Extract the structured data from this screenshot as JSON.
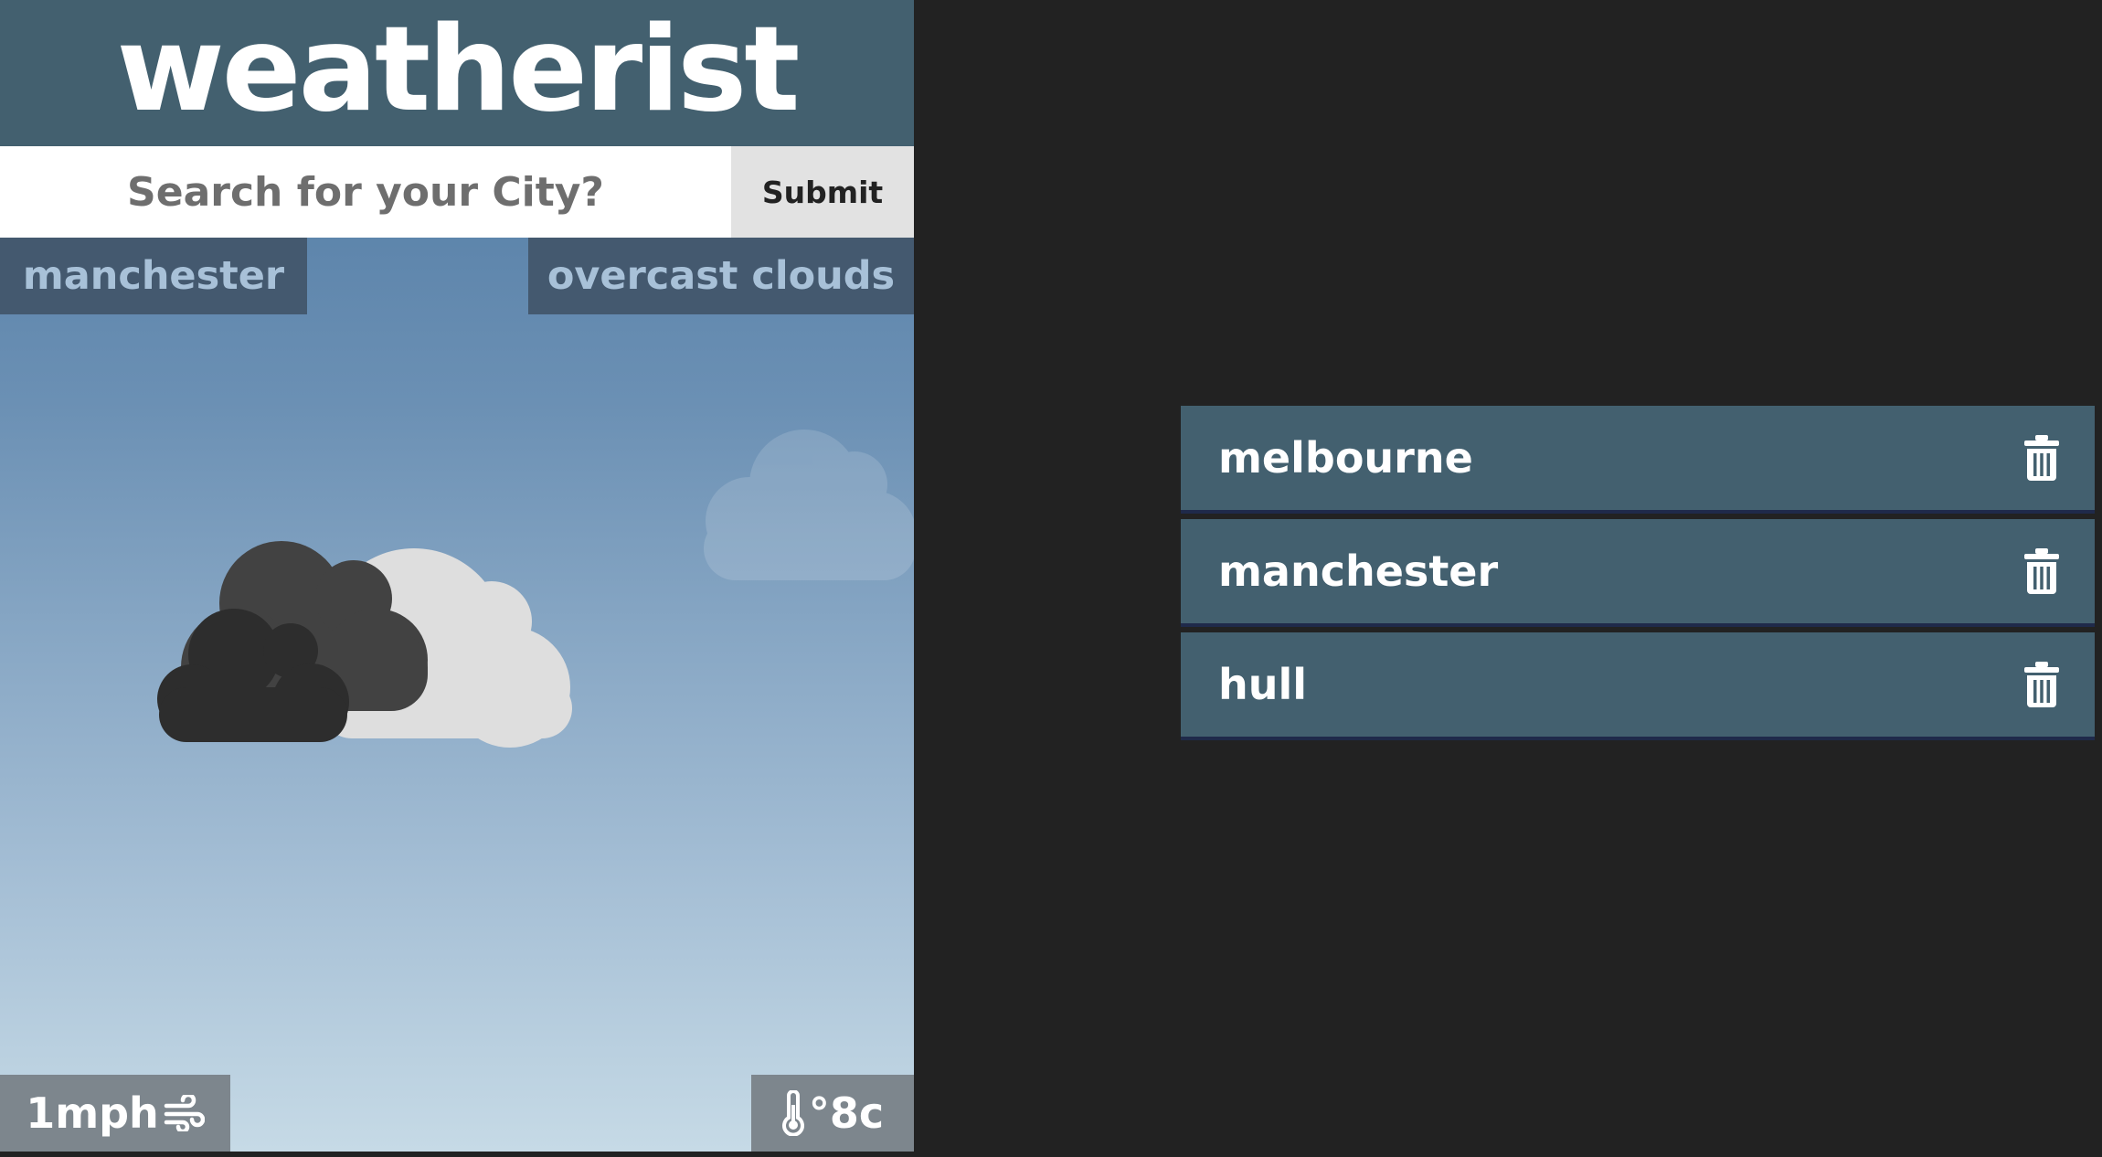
{
  "app": {
    "title": "weatherist"
  },
  "search": {
    "placeholder": "Search for your City?",
    "value": "",
    "submit_label": "Submit"
  },
  "current": {
    "city": "manchester",
    "condition": "overcast clouds",
    "wind": "1mph",
    "temperature": "°8c"
  },
  "saved_cities": [
    {
      "name": "melbourne"
    },
    {
      "name": "manchester"
    },
    {
      "name": "hull"
    }
  ],
  "icons": {
    "weather": "overcast-clouds-icon",
    "wind": "wind-icon",
    "temperature": "thermometer-icon",
    "delete": "trash-icon"
  },
  "colors": {
    "page_background": "#222222",
    "header": "#43606f",
    "sky_top": "#4b76a0",
    "sky_bottom": "#c6dae6",
    "list_item": "#43606f",
    "tag_text": "#a8c1d8"
  }
}
